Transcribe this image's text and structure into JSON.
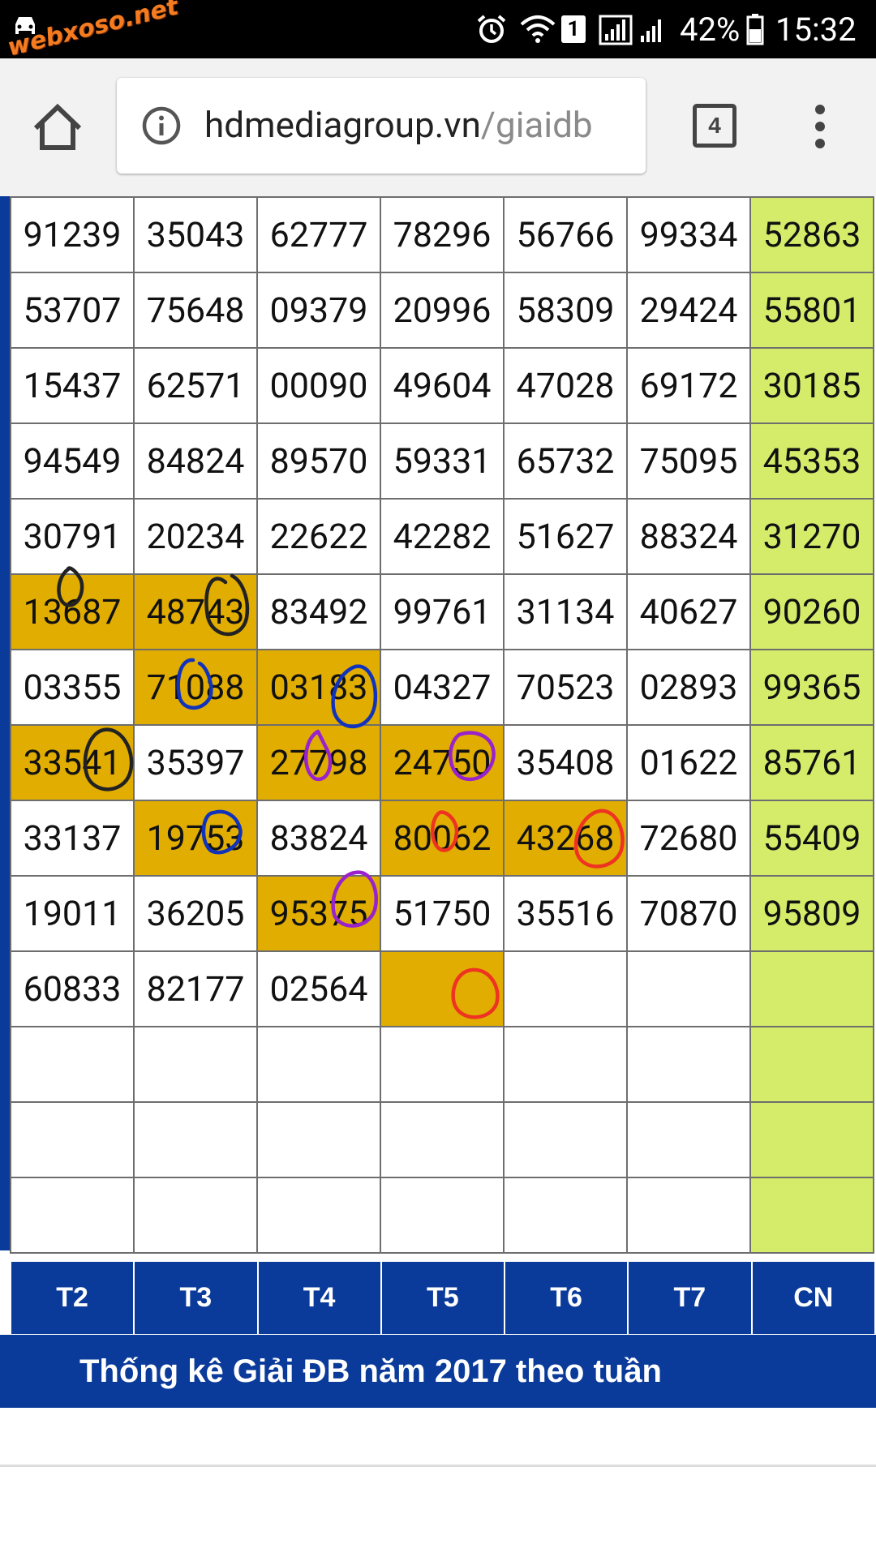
{
  "watermark": {
    "text": "webxoso.net"
  },
  "status_bar": {
    "badge": "1",
    "battery": "42%",
    "time": "15:32",
    "icons": [
      "car-icon",
      "alarm-icon",
      "wifi-icon",
      "sim-icon",
      "signal-icon",
      "battery-icon"
    ]
  },
  "browser": {
    "url_host": "hdmediagroup.vn",
    "url_path": "/giaidb",
    "tab_count": "4"
  },
  "table": {
    "rows": [
      [
        "91239",
        "35043",
        "62777",
        "78296",
        "56766",
        "99334",
        "52863"
      ],
      [
        "53707",
        "75648",
        "09379",
        "20996",
        "58309",
        "29424",
        "55801"
      ],
      [
        "15437",
        "62571",
        "00090",
        "49604",
        "47028",
        "69172",
        "30185"
      ],
      [
        "94549",
        "84824",
        "89570",
        "59331",
        "65732",
        "75095",
        "45353"
      ],
      [
        "30791",
        "20234",
        "22622",
        "42282",
        "51627",
        "88324",
        "31270"
      ],
      [
        "13687",
        "48743",
        "83492",
        "99761",
        "31134",
        "40627",
        "90260"
      ],
      [
        "03355",
        "71088",
        "03183",
        "04327",
        "70523",
        "02893",
        "99365"
      ],
      [
        "33541",
        "35397",
        "27798",
        "24750",
        "35408",
        "01622",
        "85761"
      ],
      [
        "33137",
        "19753",
        "83824",
        "80062",
        "43268",
        "72680",
        "55409"
      ],
      [
        "19011",
        "36205",
        "95375",
        "51750",
        "35516",
        "70870",
        "95809"
      ],
      [
        "60833",
        "82177",
        "02564",
        "",
        "",
        "",
        ""
      ],
      [
        "",
        "",
        "",
        "",
        "",
        "",
        ""
      ],
      [
        "",
        "",
        "",
        "",
        "",
        "",
        ""
      ],
      [
        "",
        "",
        "",
        "",
        "",
        "",
        ""
      ]
    ],
    "highlighted": [
      [
        5,
        0
      ],
      [
        5,
        1
      ],
      [
        6,
        1
      ],
      [
        6,
        2
      ],
      [
        7,
        0
      ],
      [
        7,
        2
      ],
      [
        7,
        3
      ],
      [
        8,
        1
      ],
      [
        8,
        3
      ],
      [
        8,
        4
      ],
      [
        9,
        2
      ],
      [
        10,
        3
      ]
    ],
    "days": [
      "T2",
      "T3",
      "T4",
      "T5",
      "T6",
      "T7",
      "CN"
    ],
    "caption": "Thống kê Giải ĐB năm 2017 theo tuần"
  },
  "colors": {
    "header_blue": "#0a3b9a",
    "highlight": "#e0ad00",
    "sunday_column": "#d4ec6a"
  }
}
